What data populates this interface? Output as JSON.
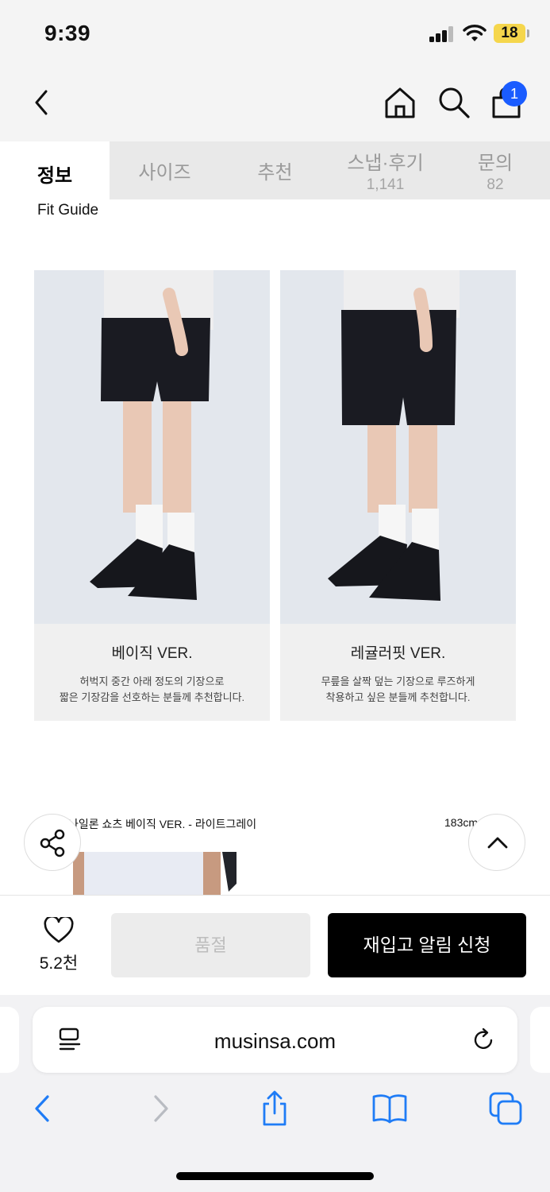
{
  "status_bar": {
    "time": "9:39",
    "battery": "18"
  },
  "header": {
    "cart_count": "1"
  },
  "tabs": [
    {
      "label": "정보",
      "count": ""
    },
    {
      "label": "사이즈",
      "count": ""
    },
    {
      "label": "추천",
      "count": ""
    },
    {
      "label": "스냅·후기",
      "count": "1,141"
    },
    {
      "label": "문의",
      "count": "82"
    }
  ],
  "fit_guide": "Fit Guide",
  "cards": [
    {
      "title": "베이직 VER.",
      "description": "허벅지 중간 아래 정도의 기장으로\n짧은 기장감을 선호하는 분들께 추천합니다."
    },
    {
      "title": "레귤러핏 VER.",
      "description": "무릎을 살짝 덮는 기장으로 루즈하게\n착용하고 싶은 분들께 추천합니다."
    }
  ],
  "product_caption": " 나일론 쇼츠 베이직 VER. - 라이트그레이",
  "size_caption": "183cm",
  "action_bar": {
    "likes": "5.2천",
    "soldout_label": "품절",
    "restock_label": "재입고 알림 신청"
  },
  "browser": {
    "url": "musinsa.com"
  },
  "colors": {
    "accent_blue": "#1a5cff",
    "safari_blue": "#1f7cf6"
  }
}
